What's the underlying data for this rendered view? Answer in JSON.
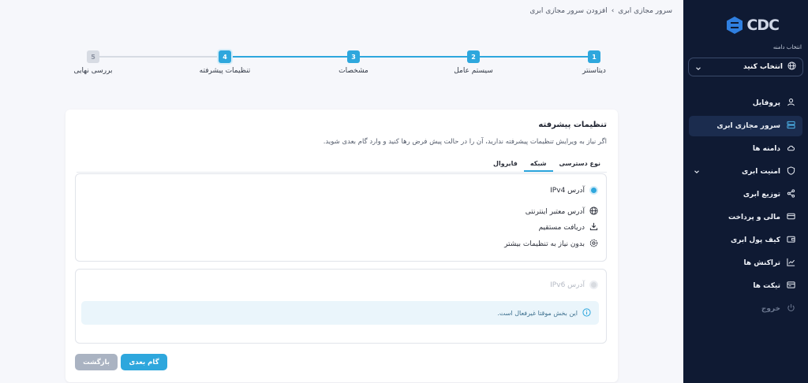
{
  "sidebar": {
    "logo_text": "CDC",
    "domain_caption": "انتخاب دامنه",
    "domain_select_label": "انتخاب کنید",
    "items": [
      {
        "label": "پروفایل",
        "icon": "user-icon"
      },
      {
        "label": "سرور مجازی ابری",
        "icon": "server-icon",
        "active": true
      },
      {
        "label": "دامنه ها",
        "icon": "cloud-icon"
      },
      {
        "label": "امنیت ابری",
        "icon": "shield-icon"
      },
      {
        "label": "توزیع ابری",
        "icon": "share-icon"
      },
      {
        "label": "مالی و پرداخت",
        "icon": "credit-card-icon"
      },
      {
        "label": "کیف پول ابری",
        "icon": "wallet-icon"
      },
      {
        "label": "تراکنش ها",
        "icon": "chart-icon"
      },
      {
        "label": "تیکت ها",
        "icon": "ticket-icon"
      },
      {
        "label": "خروج",
        "icon": "power-icon"
      }
    ]
  },
  "breadcrumb": {
    "parent": "سرور مجازی ابری",
    "separator": "›",
    "current": "افزودن سرور مجازی ابری"
  },
  "stepper": {
    "steps": [
      {
        "num": "1",
        "label": "دیتاسنتر",
        "status": "done"
      },
      {
        "num": "2",
        "label": "سیستم عامل",
        "status": "done"
      },
      {
        "num": "3",
        "label": "مشخصات",
        "status": "done"
      },
      {
        "num": "4",
        "label": "تنظیمات پیشرفته",
        "status": "current"
      },
      {
        "num": "5",
        "label": "بررسی نهایی",
        "status": "pending"
      }
    ]
  },
  "card": {
    "title": "تنظیمات پیشرفته",
    "description": "اگر نیاز به ویرایش تنظیمات پیشرفته ندارید، آن را در حالت پیش فرض رها کنید و وارد گام بعدی شوید.",
    "tabs": [
      {
        "label": "نوع دسترسی",
        "active": false
      },
      {
        "label": "شبکه",
        "active": true
      },
      {
        "label": "فایروال",
        "active": false
      }
    ],
    "ipv4": {
      "label": "آدرس IPv4",
      "options": [
        {
          "label": "آدرس معتبر اینترنتی",
          "icon": "globe-icon"
        },
        {
          "label": "دریافت مستقیم",
          "icon": "download-icon"
        },
        {
          "label": "بدون نیاز به تنظیمات بیشتر",
          "icon": "settings-icon"
        }
      ]
    },
    "ipv6": {
      "label": "آدرس IPv6",
      "info": "این بخش موقتا غیرفعال است."
    },
    "buttons": {
      "next": "گام بعدی",
      "back": "بازگشت"
    }
  },
  "colors": {
    "accent": "#2ea7dd",
    "sidebar_bg": "#0f1a33",
    "page_bg": "#f6f7fb"
  }
}
